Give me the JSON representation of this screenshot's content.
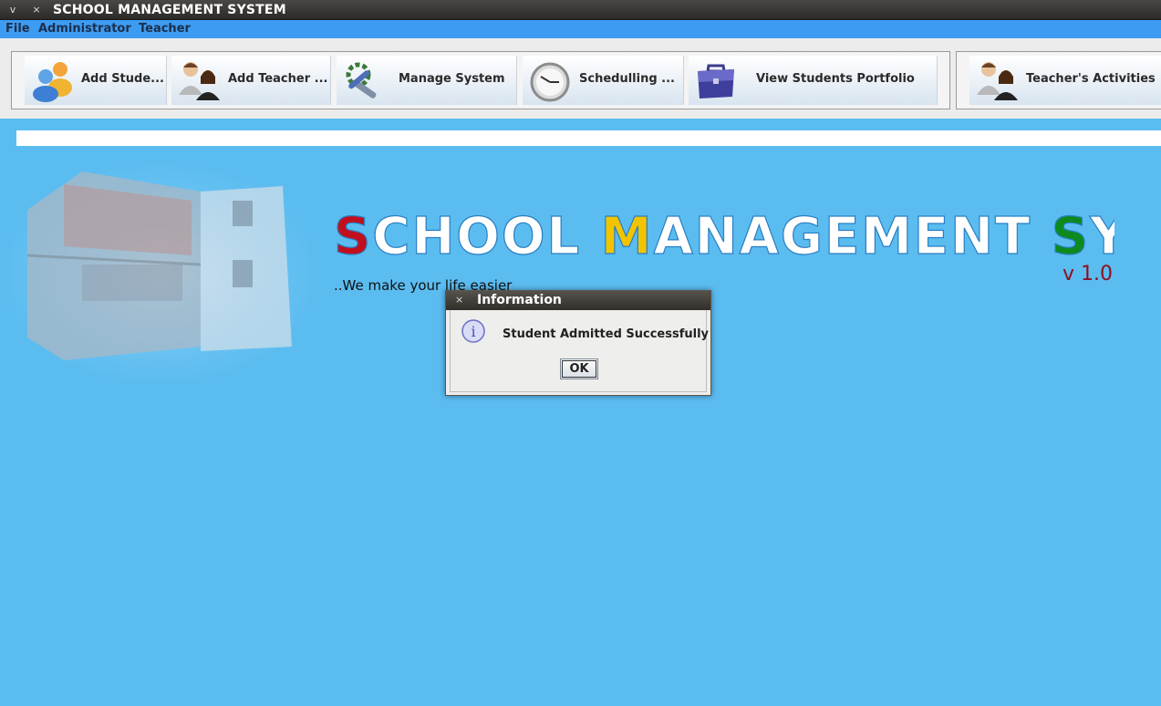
{
  "window": {
    "title": "SCHOOL MANAGEMENT SYSTEM",
    "minimize_glyph": "v",
    "close_glyph": "×"
  },
  "menu": [
    "File",
    "Administrator",
    "Teacher"
  ],
  "toolbar": {
    "add_student": "Add Stude...",
    "add_teacher": "Add Teacher  ...",
    "manage_system": "Manage System",
    "scheduling": "Schedulling     ...",
    "view_portfolio": "View Students Portfolio",
    "teacher_activities": "Teacher's  Activities"
  },
  "banner": {
    "logo_text": "SCHOOL MANAGEMENT SYSTEM",
    "version": "v 1.0",
    "tagline": "..We make your life easier",
    "logo_colors": {
      "base": "#ffffff",
      "S": "#c0101e",
      "M": "#f2c400",
      "S2": "#0c8a1e",
      "outline": "#2a7fc4"
    }
  },
  "dialog": {
    "title": "Information",
    "close_glyph": "×",
    "message": "Student Admitted Successfully",
    "ok_label": "OK"
  }
}
